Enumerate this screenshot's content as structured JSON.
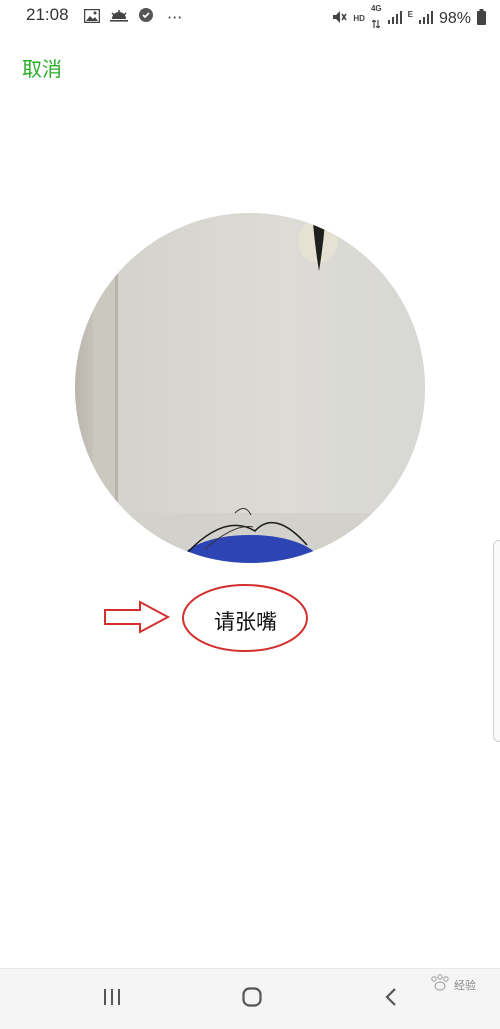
{
  "status_bar": {
    "time": "21:08",
    "more": "···",
    "signal_label_1": "4G",
    "signal_label_2": "E",
    "hd_label": "HD",
    "battery": "98%"
  },
  "header": {
    "cancel_label": "取消",
    "cancel_color": "#2aae2a"
  },
  "face_capture": {
    "prompt": "请张嘴"
  },
  "annotation": {
    "color": "#d32f2f"
  },
  "navbar": {
    "recents_icon": "recents-icon",
    "home_icon": "home-icon",
    "back_icon": "back-icon"
  },
  "watermark": {
    "text": "经验"
  }
}
